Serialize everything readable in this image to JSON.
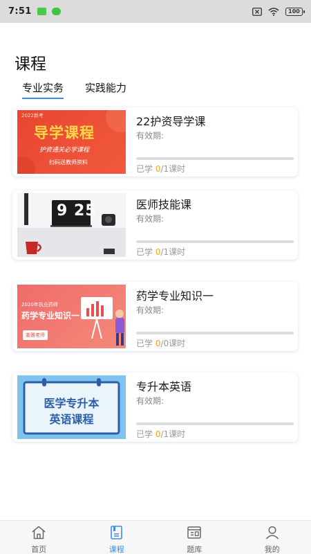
{
  "status_bar": {
    "time": "7:51",
    "battery": "100"
  },
  "page": {
    "title": "课程"
  },
  "tabs": [
    {
      "label": "专业实务",
      "active": true
    },
    {
      "label": "实践能力",
      "active": false
    }
  ],
  "courses": [
    {
      "title": "22护资导学课",
      "valid_label": "有效期:",
      "progress_prefix": "已学 ",
      "learned": "0",
      "progress_suffix": "/1课时",
      "progress_fraction": 0,
      "thumb": {
        "year_tag": "2022新考",
        "headline": "导学课程",
        "sub": "护资通关必学课程",
        "foot": "扫码送教师资料"
      }
    },
    {
      "title": "医师技能课",
      "valid_label": "有效期:",
      "progress_prefix": "已学 ",
      "learned": "0",
      "progress_suffix": "/1课时",
      "progress_fraction": 0,
      "thumb": {
        "clock": "9 25"
      }
    },
    {
      "title": "药学专业知识一",
      "valid_label": "有效期:",
      "progress_prefix": "已学 ",
      "learned": "0",
      "progress_suffix": "/0课时",
      "progress_fraction": 0,
      "thumb": {
        "tag": "2020年执业药师",
        "headline": "药学专业知识一",
        "teacher": "姜雅老师"
      }
    },
    {
      "title": "专升本英语",
      "valid_label": "有效期:",
      "progress_prefix": "已学 ",
      "learned": "0",
      "progress_suffix": "/1课时",
      "progress_fraction": 0,
      "thumb": {
        "line1": "医学专升本",
        "line2": "英语课程"
      }
    }
  ],
  "bottom_nav": [
    {
      "label": "首页",
      "icon": "home-icon",
      "active": false
    },
    {
      "label": "课程",
      "icon": "course-book-icon",
      "active": true
    },
    {
      "label": "题库",
      "icon": "question-bank-icon",
      "active": false
    },
    {
      "label": "我的",
      "icon": "profile-icon",
      "active": false
    }
  ],
  "colors": {
    "accent": "#3a8ee6",
    "highlight": "#f0a020",
    "progress_track": "#dcdcdc"
  }
}
